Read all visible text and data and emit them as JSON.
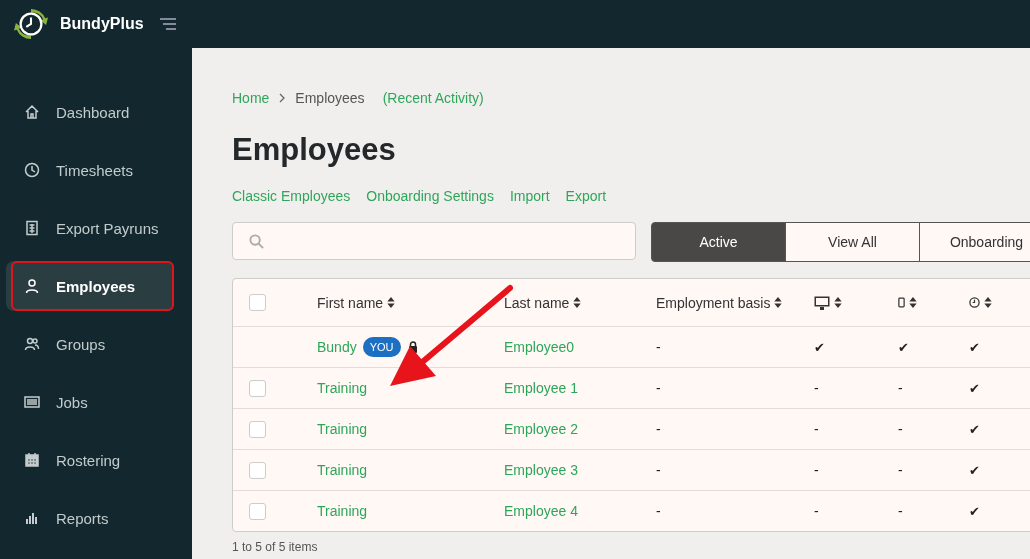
{
  "app": {
    "name": "BundyPlus"
  },
  "sidebar": {
    "items": [
      {
        "label": "Dashboard",
        "selected": false
      },
      {
        "label": "Timesheets",
        "selected": false
      },
      {
        "label": "Export Payruns",
        "selected": false
      },
      {
        "label": "Employees",
        "selected": true
      },
      {
        "label": "Groups",
        "selected": false
      },
      {
        "label": "Jobs",
        "selected": false
      },
      {
        "label": "Rostering",
        "selected": false
      },
      {
        "label": "Reports",
        "selected": false
      }
    ]
  },
  "breadcrumb": {
    "home": "Home",
    "current": "Employees",
    "extra": "(Recent Activity)"
  },
  "title": "Employees",
  "links": [
    "Classic Employees",
    "Onboarding Settings",
    "Import",
    "Export"
  ],
  "filter_tabs": [
    {
      "label": "Active",
      "selected": true
    },
    {
      "label": "View All",
      "selected": false
    },
    {
      "label": "Onboarding",
      "selected": false
    }
  ],
  "table": {
    "all_checked": false,
    "columns": [
      {
        "kind": "text",
        "label": "First name"
      },
      {
        "kind": "text",
        "label": "Last name"
      },
      {
        "kind": "text",
        "label": "Employment basis"
      },
      {
        "kind": "icon"
      },
      {
        "kind": "icon"
      },
      {
        "kind": "icon"
      }
    ],
    "rows": [
      {
        "first": "Bundy",
        "badge": "YOU",
        "last": "Employee0",
        "basis": "-",
        "desktop": "✔",
        "mobile": "✔",
        "clock": "✔"
      },
      {
        "checked": false,
        "first": "Training",
        "last": "Employee 1",
        "basis": "-",
        "desktop": "-",
        "mobile": "-",
        "clock": "✔"
      },
      {
        "checked": false,
        "first": "Training",
        "last": "Employee 2",
        "basis": "-",
        "desktop": "-",
        "mobile": "-",
        "clock": "✔"
      },
      {
        "checked": false,
        "first": "Training",
        "last": "Employee 3",
        "basis": "-",
        "desktop": "-",
        "mobile": "-",
        "clock": "✔"
      },
      {
        "checked": false,
        "first": "Training",
        "last": "Employee 4",
        "basis": "-",
        "desktop": "-",
        "mobile": "-",
        "clock": "✔"
      }
    ]
  },
  "footer": "1 to 5 of 5 items"
}
